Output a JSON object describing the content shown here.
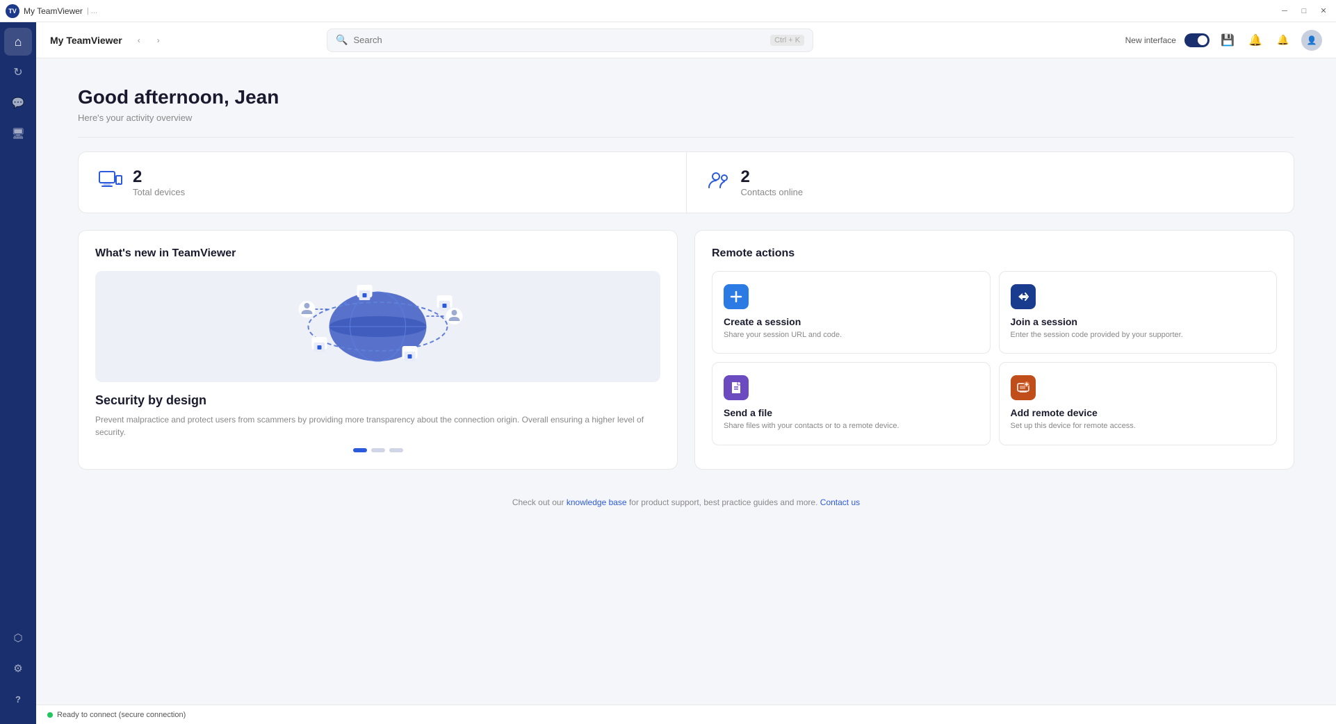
{
  "titlebar": {
    "title": "My TeamViewer",
    "logo_text": "TV",
    "window_title": "My TeamViewer"
  },
  "topbar": {
    "title": "My TeamViewer",
    "search_placeholder": "Search",
    "search_shortcut": "Ctrl + K",
    "new_interface_label": "New interface",
    "toggle_on": true
  },
  "sidebar": {
    "items": [
      {
        "id": "home",
        "icon": "⌂",
        "label": "Home",
        "active": true
      },
      {
        "id": "remote",
        "icon": "↻",
        "label": "Remote Control",
        "active": false
      },
      {
        "id": "chat",
        "icon": "💬",
        "label": "Chat",
        "active": false
      },
      {
        "id": "monitor",
        "icon": "🖥",
        "label": "Monitor",
        "active": false
      }
    ],
    "bottom_items": [
      {
        "id": "connections",
        "icon": "⬡",
        "label": "Connections",
        "active": false
      },
      {
        "id": "settings",
        "icon": "⚙",
        "label": "Settings",
        "active": false
      },
      {
        "id": "help",
        "icon": "?",
        "label": "Help",
        "active": false
      }
    ]
  },
  "page": {
    "greeting": "Good afternoon, Jean",
    "subtitle": "Here's your activity overview"
  },
  "stats": [
    {
      "id": "devices",
      "number": "2",
      "label": "Total devices"
    },
    {
      "id": "contacts",
      "number": "2",
      "label": "Contacts online"
    }
  ],
  "whats_new": {
    "title": "What's new in TeamViewer",
    "slide_title": "Security by design",
    "slide_desc": "Prevent malpractice and protect users from scammers by providing more transparency about the connection origin. Overall ensuring a higher level of security.",
    "dots": [
      true,
      false,
      false
    ]
  },
  "remote_actions": {
    "title": "Remote actions",
    "items": [
      {
        "id": "create-session",
        "icon": "+",
        "icon_class": "icon-blue",
        "title": "Create a session",
        "desc": "Share your session URL and code."
      },
      {
        "id": "join-session",
        "icon": "⇄",
        "icon_class": "icon-dark-blue",
        "title": "Join a session",
        "desc": "Enter the session code provided by your supporter."
      },
      {
        "id": "send-file",
        "icon": "📄",
        "icon_class": "icon-purple",
        "title": "Send a file",
        "desc": "Share files with your contacts or to a remote device."
      },
      {
        "id": "add-remote",
        "icon": "🖥",
        "icon_class": "icon-orange",
        "title": "Add remote device",
        "desc": "Set up this device for remote access."
      }
    ]
  },
  "footer": {
    "text_before": "Check out our ",
    "link1_text": "knowledge base",
    "text_middle": " for product support, best practice guides and more. ",
    "link2_text": "Contact us"
  },
  "status": {
    "text": "Ready to connect (secure connection)"
  },
  "icons": {
    "search": "🔍",
    "save": "💾",
    "bell": "🔔",
    "alert": "🔔",
    "user": "👤",
    "chevron_left": "‹",
    "chevron_right": "›"
  }
}
